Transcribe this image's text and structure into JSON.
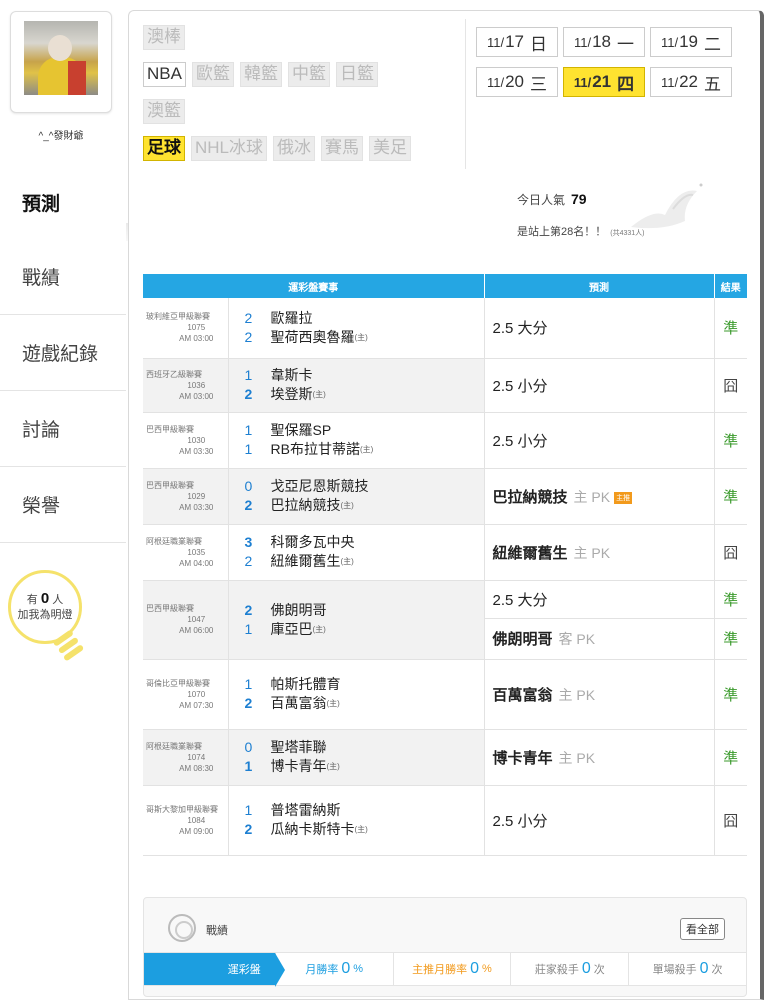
{
  "user": {
    "name": "^_^發財爺"
  },
  "nav": [
    {
      "label": "預測",
      "active": true
    },
    {
      "label": "戰績"
    },
    {
      "label": "遊戲紀錄"
    },
    {
      "label": "討論"
    },
    {
      "label": "榮譽"
    }
  ],
  "fans": {
    "prefix": "有",
    "count": "0",
    "suffix": "人",
    "line2": "加我為明燈"
  },
  "sports": {
    "row1": [
      "澳棒"
    ],
    "row2": [
      "NBA",
      "歐籃",
      "韓籃",
      "中籃",
      "日籃"
    ],
    "row3": [
      "澳籃"
    ],
    "row4": [
      "足球",
      "NHL冰球",
      "俄冰",
      "賽馬",
      "美足"
    ]
  },
  "dates": [
    {
      "md": "11/",
      "d": "17",
      "wd": "日"
    },
    {
      "md": "11/",
      "d": "18",
      "wd": "一"
    },
    {
      "md": "11/",
      "d": "19",
      "wd": "二"
    },
    {
      "md": "11/",
      "d": "20",
      "wd": "三"
    },
    {
      "md": "11/",
      "d": "21",
      "wd": "四",
      "selected": true
    },
    {
      "md": "11/",
      "d": "22",
      "wd": "五"
    }
  ],
  "popularity": {
    "label": "今日人氣",
    "value": "79",
    "rank": "是站上第28名！！",
    "total": "(共4331人)"
  },
  "table": {
    "headers": [
      "運彩盤賽事",
      "預測",
      "結果"
    ],
    "home_mark": "(主)",
    "rows": [
      {
        "league": "玻利維亞甲級聯賽",
        "code": "1075",
        "time": "AM 03:00",
        "away": {
          "score": "2",
          "name": "歐羅拉"
        },
        "home": {
          "score": "2",
          "name": "聖荷西奧魯羅"
        },
        "preds": [
          {
            "pick": "2.5 大分",
            "sub": "",
            "result": "準"
          }
        ]
      },
      {
        "league": "西班牙乙級聯賽",
        "code": "1036",
        "time": "AM 03:00",
        "away": {
          "score": "1",
          "name": "韋斯卡"
        },
        "home": {
          "score": "2",
          "name": "埃登斯"
        },
        "preds": [
          {
            "pick": "2.5 小分",
            "sub": "",
            "result": "囧"
          }
        ]
      },
      {
        "league": "巴西甲級聯賽",
        "code": "1030",
        "time": "AM 03:30",
        "away": {
          "score": "1",
          "name": "聖保羅SP"
        },
        "home": {
          "score": "1",
          "name": "RB布拉甘蒂諾"
        },
        "preds": [
          {
            "pick": "2.5 小分",
            "sub": "",
            "result": "準"
          }
        ]
      },
      {
        "league": "巴西甲級聯賽",
        "code": "1029",
        "time": "AM 03:30",
        "away": {
          "score": "0",
          "name": "戈亞尼恩斯競技"
        },
        "home": {
          "score": "2",
          "name": "巴拉納競技"
        },
        "preds": [
          {
            "pick": "巴拉納競技",
            "sub": "主 PK",
            "badge": "主推",
            "result": "準"
          }
        ]
      },
      {
        "league": "阿根廷職業聯賽",
        "code": "1035",
        "time": "AM 04:00",
        "away": {
          "score": "3",
          "name": "科爾多瓦中央"
        },
        "home": {
          "score": "2",
          "name": "紐維爾舊生"
        },
        "preds": [
          {
            "pick": "紐維爾舊生",
            "sub": "主 PK",
            "result": "囧"
          }
        ]
      },
      {
        "league": "巴西甲級聯賽",
        "code": "1047",
        "time": "AM 06:00",
        "away": {
          "score": "2",
          "name": "佛朗明哥"
        },
        "home": {
          "score": "1",
          "name": "庫亞巴"
        },
        "preds": [
          {
            "pick": "2.5 大分",
            "sub": "",
            "result": "準"
          },
          {
            "pick": "佛朗明哥",
            "sub": "客 PK",
            "result": "準"
          }
        ]
      },
      {
        "league": "哥倫比亞甲級聯賽",
        "code": "1070",
        "time": "AM 07:30",
        "away": {
          "score": "1",
          "name": "帕斯托體育"
        },
        "home": {
          "score": "2",
          "name": "百萬富翁"
        },
        "preds": [
          {
            "pick": "百萬富翁",
            "sub": "主 PK",
            "result": "準"
          }
        ]
      },
      {
        "league": "阿根廷職業聯賽",
        "code": "1074",
        "time": "AM 08:30",
        "away": {
          "score": "0",
          "name": "聖塔菲聯"
        },
        "home": {
          "score": "1",
          "name": "博卡青年"
        },
        "preds": [
          {
            "pick": "博卡青年",
            "sub": "主 PK",
            "result": "準"
          }
        ]
      },
      {
        "league": "哥斯大黎加甲級聯賽",
        "code": "1084",
        "time": "AM 09:00",
        "away": {
          "score": "1",
          "name": "普塔雷納斯"
        },
        "home": {
          "score": "2",
          "name": "瓜納卡斯特卡"
        },
        "preds": [
          {
            "pick": "2.5 小分",
            "sub": "",
            "result": "囧"
          }
        ]
      }
    ]
  },
  "stats": {
    "title": "戰績",
    "see_all": "看全部",
    "items": [
      {
        "label": "運彩盤",
        "value": "",
        "unit": ""
      },
      {
        "label": "月勝率",
        "value": "0",
        "unit": "%"
      },
      {
        "label": "主推月勝率",
        "value": "0",
        "unit": "%"
      },
      {
        "label": "莊家殺手",
        "value": "0",
        "unit": "次"
      },
      {
        "label": "單場殺手",
        "value": "0",
        "unit": "次"
      }
    ]
  }
}
